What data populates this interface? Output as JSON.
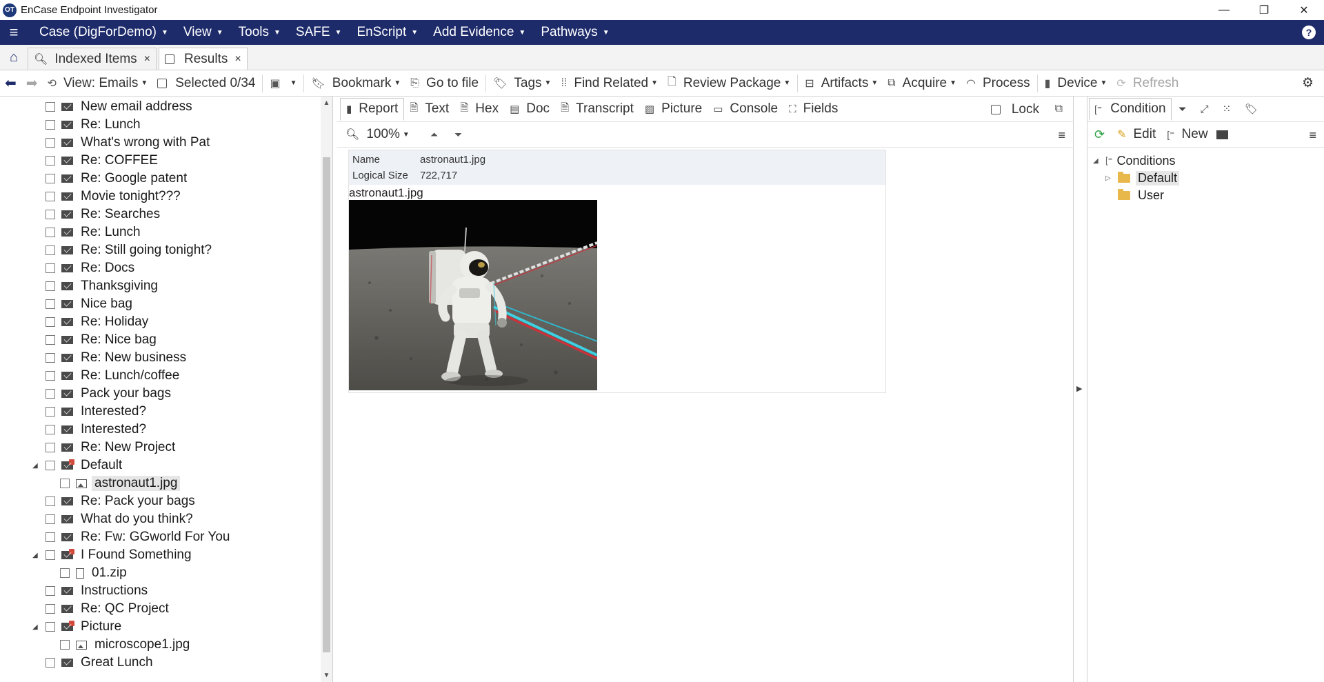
{
  "window": {
    "title": "EnCase Endpoint Investigator",
    "logo_text": "OT",
    "minimize": "—",
    "restore": "❐",
    "close": "✕"
  },
  "menu": {
    "items": [
      {
        "label": "Case (DigForDemo)"
      },
      {
        "label": "View"
      },
      {
        "label": "Tools"
      },
      {
        "label": "SAFE"
      },
      {
        "label": "EnScript"
      },
      {
        "label": "Add Evidence"
      },
      {
        "label": "Pathways"
      }
    ],
    "help": "?"
  },
  "tabs": {
    "items": [
      {
        "label": "Indexed Items",
        "active": false
      },
      {
        "label": "Results",
        "active": true
      }
    ]
  },
  "toolbar": {
    "view": "View: Emails",
    "selected": "Selected 0/34",
    "bookmark": "Bookmark",
    "go_to_file": "Go to file",
    "tags": "Tags",
    "find_related": "Find Related",
    "review_package": "Review Package",
    "artifacts": "Artifacts",
    "acquire": "Acquire",
    "process": "Process",
    "device": "Device",
    "refresh": "Refresh"
  },
  "tree": {
    "items": [
      {
        "label": "New email address",
        "type": "mail",
        "level": 0
      },
      {
        "label": "Re: Lunch",
        "type": "mail",
        "level": 0
      },
      {
        "label": "What's wrong with Pat",
        "type": "mail",
        "level": 0
      },
      {
        "label": "Re: COFFEE",
        "type": "mail",
        "level": 0
      },
      {
        "label": "Re: Google patent",
        "type": "mail",
        "level": 0
      },
      {
        "label": "Movie tonight???",
        "type": "mail",
        "level": 0
      },
      {
        "label": "Re: Searches",
        "type": "mail",
        "level": 0
      },
      {
        "label": "Re: Lunch",
        "type": "mail",
        "level": 0
      },
      {
        "label": "Re: Still going tonight?",
        "type": "mail",
        "level": 0
      },
      {
        "label": "Re: Docs",
        "type": "mail",
        "level": 0
      },
      {
        "label": "Thanksgiving",
        "type": "mail",
        "level": 0
      },
      {
        "label": "Nice bag",
        "type": "mail",
        "level": 0
      },
      {
        "label": "Re: Holiday",
        "type": "mail",
        "level": 0
      },
      {
        "label": "Re: Nice bag",
        "type": "mail",
        "level": 0
      },
      {
        "label": "Re: New business",
        "type": "mail",
        "level": 0
      },
      {
        "label": "Re: Lunch/coffee",
        "type": "mail",
        "level": 0
      },
      {
        "label": "Pack your bags",
        "type": "mail",
        "level": 0
      },
      {
        "label": "Interested?",
        "type": "mail",
        "level": 0
      },
      {
        "label": "Interested?",
        "type": "mail",
        "level": 0
      },
      {
        "label": "Re: New Project",
        "type": "mail",
        "level": 0
      },
      {
        "label": "Default",
        "type": "mail-attach",
        "level": 0,
        "expanded": true
      },
      {
        "label": "astronaut1.jpg",
        "type": "image",
        "level": 1,
        "selected": true
      },
      {
        "label": "Re: Pack your bags",
        "type": "mail",
        "level": 0
      },
      {
        "label": "What do you think?",
        "type": "mail",
        "level": 0
      },
      {
        "label": "Re: Fw: GGworld For You",
        "type": "mail",
        "level": 0
      },
      {
        "label": "I Found Something",
        "type": "mail-attach",
        "level": 0,
        "expanded": true
      },
      {
        "label": "01.zip",
        "type": "file",
        "level": 1
      },
      {
        "label": "Instructions",
        "type": "mail",
        "level": 0
      },
      {
        "label": "Re: QC Project",
        "type": "mail",
        "level": 0
      },
      {
        "label": "Picture",
        "type": "mail-attach",
        "level": 0,
        "expanded": true
      },
      {
        "label": "microscope1.jpg",
        "type": "image",
        "level": 1
      },
      {
        "label": "Great Lunch",
        "type": "mail",
        "level": 0
      }
    ]
  },
  "viewer": {
    "tabs": [
      "Report",
      "Text",
      "Hex",
      "Doc",
      "Transcript",
      "Picture",
      "Console",
      "Fields"
    ],
    "lock_label": "Lock",
    "zoom": "100%",
    "report": {
      "name_key": "Name",
      "name_value": "astronaut1.jpg",
      "size_key": "Logical Size",
      "size_value": "722,717",
      "caption": "astronaut1.jpg"
    }
  },
  "conditions": {
    "tab_label": "Condition",
    "edit": "Edit",
    "new": "New",
    "root": "Conditions",
    "items": [
      {
        "label": "Default",
        "selected": true,
        "has_children": true
      },
      {
        "label": "User",
        "selected": false,
        "has_children": false
      }
    ]
  }
}
